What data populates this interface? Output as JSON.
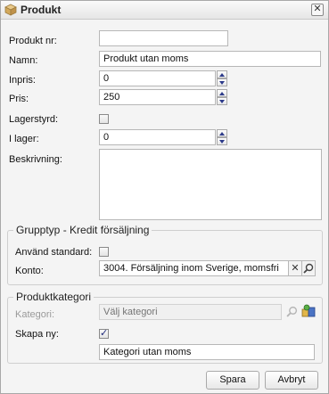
{
  "dialog": {
    "title": "Produkt"
  },
  "fields": {
    "produkt_nr": {
      "label": "Produkt nr:",
      "value": ""
    },
    "namn": {
      "label": "Namn:",
      "value": "Produkt utan moms"
    },
    "inpris": {
      "label": "Inpris:",
      "value": "0"
    },
    "pris": {
      "label": "Pris:",
      "value": "250"
    },
    "lagerstyrd": {
      "label": "Lagerstyrd:",
      "checked": false
    },
    "i_lager": {
      "label": "I lager:",
      "value": "0"
    },
    "beskrivning": {
      "label": "Beskrivning:",
      "value": ""
    }
  },
  "grupptyp": {
    "legend": "Grupptyp - Kredit försäljning",
    "anvand_standard": {
      "label": "Använd standard:",
      "checked": false
    },
    "konto": {
      "label": "Konto:",
      "value": "3004. Försäljning inom Sverige, momsfri"
    }
  },
  "produktkategori": {
    "legend": "Produktkategori",
    "kategori": {
      "label": "Kategori:",
      "placeholder": "Välj kategori",
      "disabled": true
    },
    "skapa_ny": {
      "label": "Skapa ny:",
      "checked": true
    },
    "ny_kategori": {
      "value": "Kategori utan moms"
    }
  },
  "buttons": {
    "save": "Spara",
    "cancel": "Avbryt"
  },
  "colors": {
    "accent": "#2c3a8a",
    "background": "#f4f4f4",
    "border": "#b7b7b7"
  }
}
